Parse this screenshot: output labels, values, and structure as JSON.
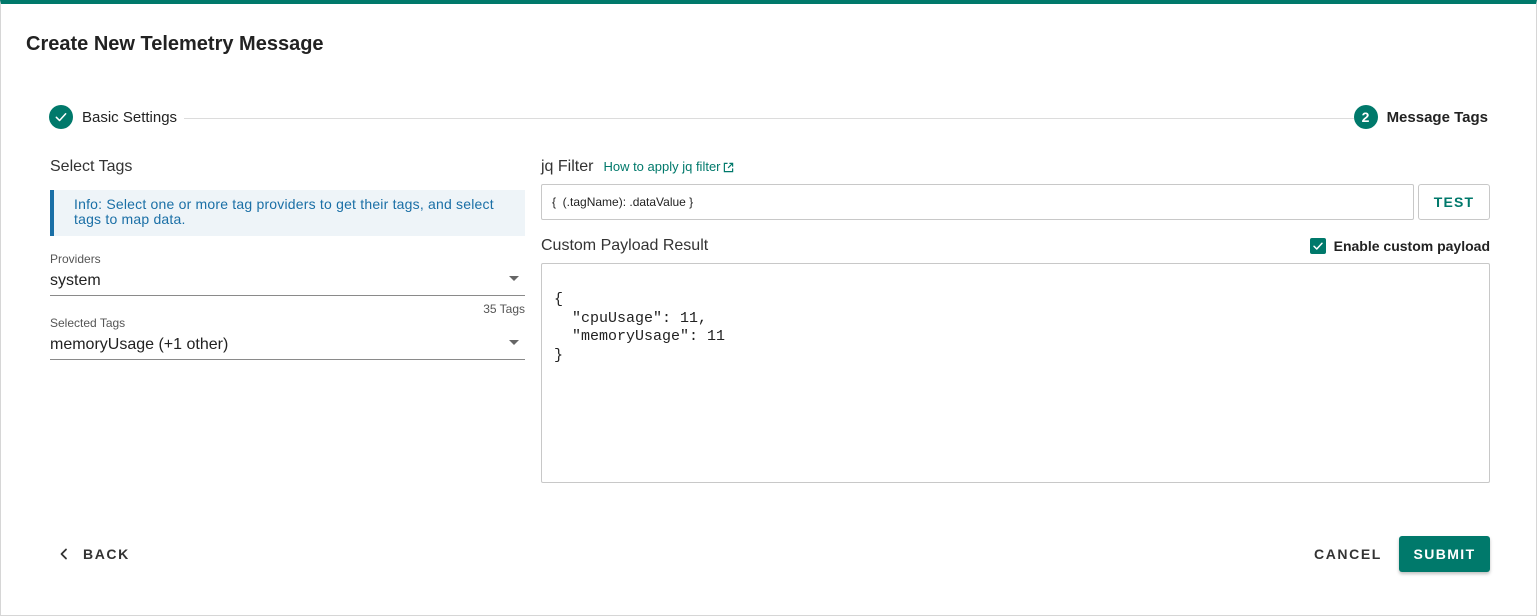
{
  "dialog": {
    "title": "Create New Telemetry Message"
  },
  "stepper": {
    "steps": [
      {
        "label": "Basic Settings",
        "state": "completed",
        "icon": "check-icon"
      },
      {
        "label": "Message Tags",
        "number": "2",
        "state": "active"
      }
    ]
  },
  "select_tags": {
    "heading": "Select Tags",
    "info": "Info: Select one or more tag providers to get their tags, and select tags to map data.",
    "providers": {
      "label": "Providers",
      "value": "system",
      "helper": "35 Tags"
    },
    "selected_tags": {
      "label": "Selected Tags",
      "value": "memoryUsage (+1 other)"
    }
  },
  "jq_filter": {
    "heading": "jq Filter",
    "help_link": "How to apply jq filter",
    "value": "{  (.tagName): .dataValue }",
    "test_label": "TEST"
  },
  "payload": {
    "heading": "Custom Payload Result",
    "enable_label": "Enable custom payload",
    "enable_checked": true,
    "result": "{\n  \"cpuUsage\": 11,\n  \"memoryUsage\": 11\n}"
  },
  "footer": {
    "back_label": "BACK",
    "cancel_label": "CANCEL",
    "submit_label": "SUBMIT"
  },
  "colors": {
    "accent": "#00796b",
    "info_text": "#1a6fa6",
    "info_background": "#eef4f8"
  }
}
